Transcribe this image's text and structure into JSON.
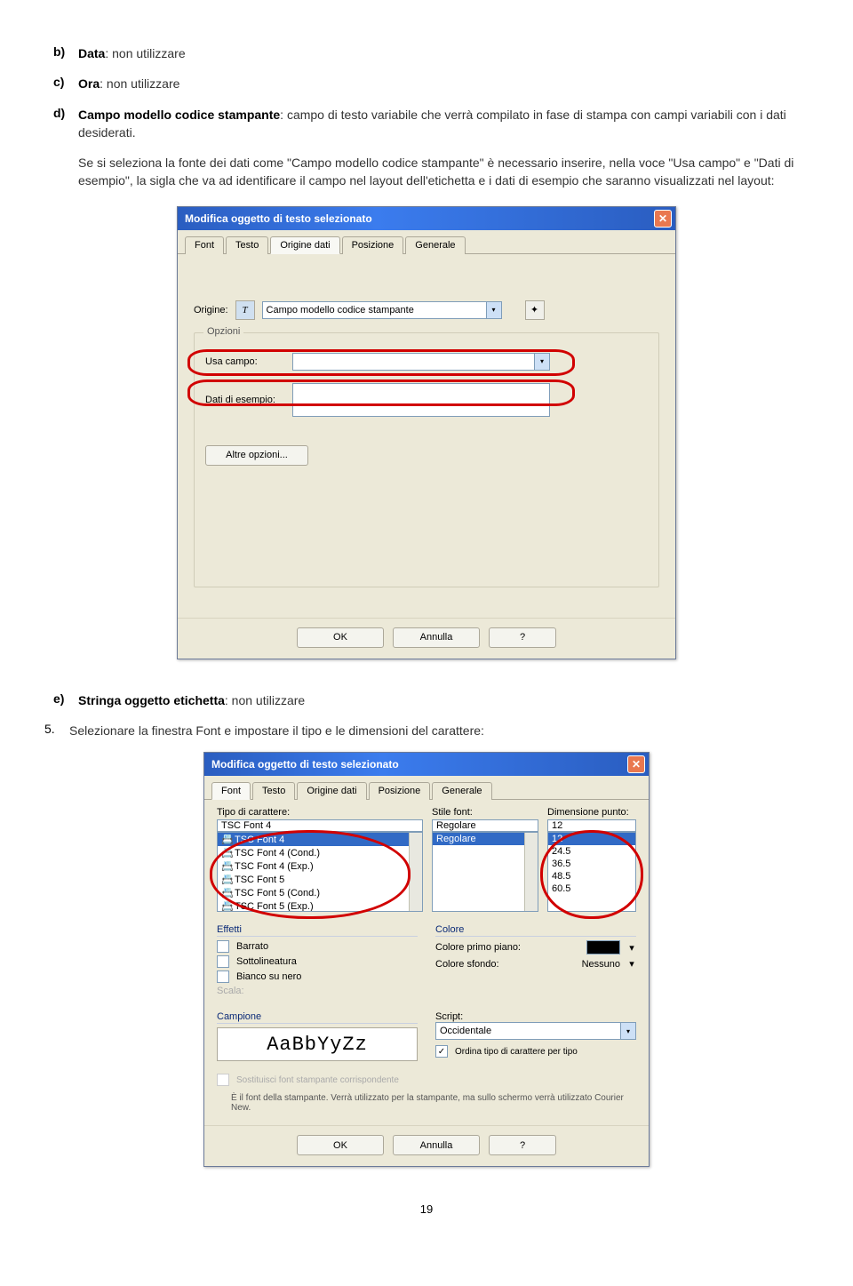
{
  "list": {
    "b": {
      "marker": "b)",
      "label": "Data",
      "rest": ": non utilizzare"
    },
    "c": {
      "marker": "c)",
      "label": "Ora",
      "rest": ": non utilizzare"
    },
    "d": {
      "marker": "d)",
      "label": "Campo modello codice stampante",
      "rest": ": campo di testo variabile che verrà compilato in fase di stampa con campi variabili con i dati desiderati."
    },
    "e": {
      "marker": "e)",
      "label": "Stringa oggetto etichetta",
      "rest": ": non utilizzare"
    }
  },
  "para1": "Se si seleziona la fonte dei dati come \"Campo modello codice stampante\" è necessario inserire, nella voce \"Usa campo\" e \"Dati di esempio\", la sigla che va ad identificare il campo nel layout dell'etichetta e i dati di esempio che saranno visualizzati nel layout:",
  "step5": {
    "marker": "5.",
    "text": "Selezionare la finestra Font e impostare il tipo e le dimensioni del carattere:"
  },
  "dlg1": {
    "title": "Modifica oggetto di testo selezionato",
    "tabs": [
      "Font",
      "Testo",
      "Origine dati",
      "Posizione",
      "Generale"
    ],
    "activeTab": 2,
    "origine_label": "Origine:",
    "origine_value": "Campo modello codice stampante",
    "opzioni": "Opzioni",
    "usa_campo_label": "Usa campo:",
    "dati_esempio_label": "Dati di esempio:",
    "altre_opzioni": "Altre opzioni...",
    "ok": "OK",
    "annulla": "Annulla",
    "help": "?"
  },
  "dlg2": {
    "title": "Modifica oggetto di testo selezionato",
    "tabs": [
      "Font",
      "Testo",
      "Origine dati",
      "Posizione",
      "Generale"
    ],
    "activeTab": 0,
    "col_tipo": "Tipo di carattere:",
    "tipo_value": "TSC Font 4",
    "tipo_list": [
      "TSC Font 4",
      "TSC Font 4 (Cond.)",
      "TSC Font 4 (Exp.)",
      "TSC Font 5",
      "TSC Font 5 (Cond.)",
      "TSC Font 5 (Exp.)"
    ],
    "col_stile": "Stile font:",
    "stile_value": "Regolare",
    "stile_list": [
      "Regolare"
    ],
    "col_dim": "Dimensione punto:",
    "dim_value": "12",
    "dim_list": [
      "12",
      "24.5",
      "36.5",
      "48.5",
      "60.5"
    ],
    "sect_effetti": "Effetti",
    "eff1": "Barrato",
    "eff2": "Sottolineatura",
    "eff3": "Bianco su nero",
    "scala": "Scala:",
    "sect_colore": "Colore",
    "colore_primo": "Colore primo piano:",
    "colore_sfondo": "Colore sfondo:",
    "sfondo_value": "Nessuno",
    "sect_campione": "Campione",
    "sample": "AaBbYyZz",
    "script_label": "Script:",
    "script_value": "Occidentale",
    "ordina_chk": "Ordina tipo di carattere per tipo",
    "sost_chk": "Sostituisci font stampante corrispondente",
    "note": "È il font della stampante. Verrà utilizzato per la stampante, ma sullo schermo verrà utilizzato Courier New.",
    "ok": "OK",
    "annulla": "Annulla",
    "help": "?"
  },
  "page": "19"
}
